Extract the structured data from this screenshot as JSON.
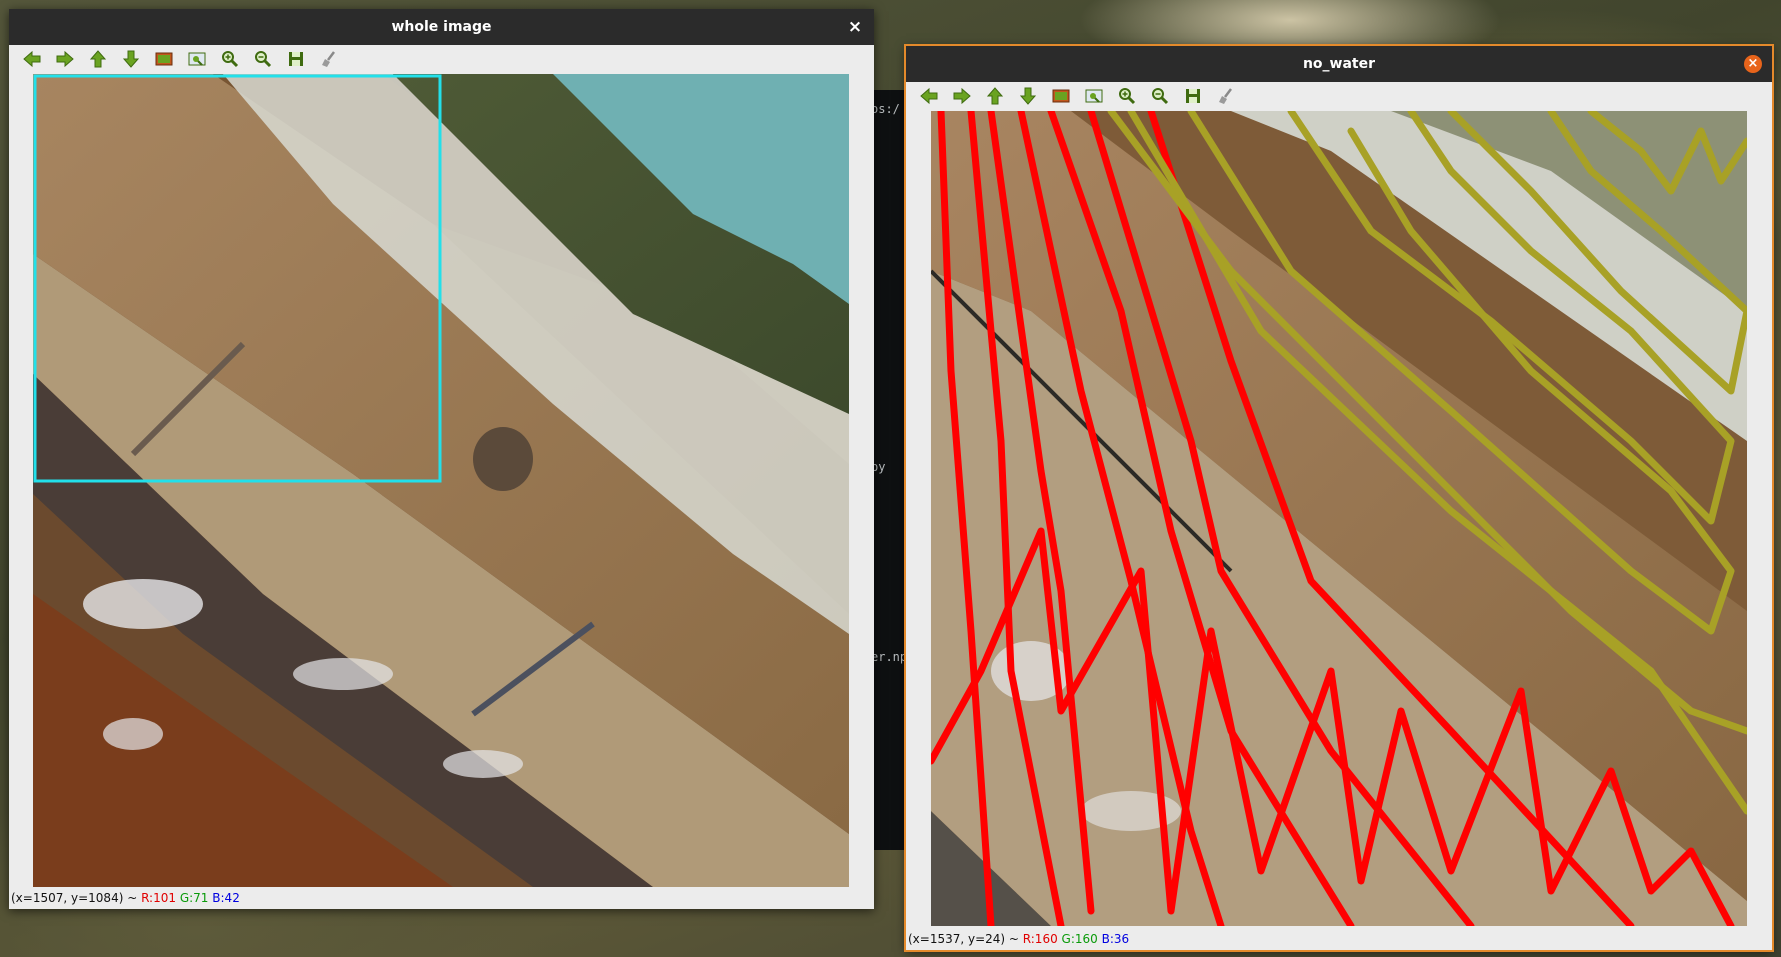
{
  "colors": {
    "selection_rect": "#22e0ea",
    "red_strokes": "#ff0000",
    "olive_strokes": "#a8a126",
    "water_mask": "#6fb0b2",
    "focus_border": "#e48a2b"
  },
  "terminal": {
    "lines": [
      "os:/",
      "py",
      "er.np"
    ]
  },
  "toolbar_icons": [
    "arrow-left-icon",
    "arrow-right-icon",
    "arrow-up-icon",
    "arrow-down-icon",
    "image-icon",
    "fit-window-icon",
    "zoom-in-icon",
    "zoom-out-icon",
    "save-icon",
    "clear-icon"
  ],
  "windows": {
    "whole": {
      "title": "whole image",
      "close_label": "×",
      "status": {
        "coords": "(x=1507, y=1084) ~ ",
        "r": "R:101",
        "g": "G:71",
        "b": "B:42"
      }
    },
    "no_water": {
      "title": "no_water",
      "close_label": "×",
      "status": {
        "coords": "(x=1537, y=24) ~ ",
        "r": "R:160",
        "g": "G:160",
        "b": "B:36"
      }
    }
  }
}
